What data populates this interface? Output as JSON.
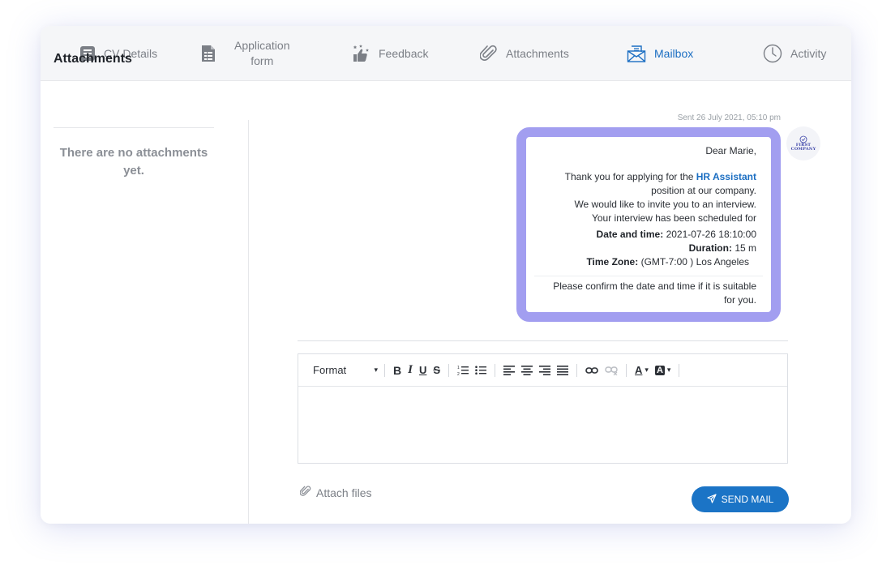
{
  "tabs": [
    {
      "label": "CV Details",
      "icon": "cv-icon"
    },
    {
      "label": "Application form",
      "line1": "Application",
      "line2": "form",
      "icon": "form-icon"
    },
    {
      "label": "Feedback",
      "icon": "thumbs-up-stars-icon"
    },
    {
      "label": "Attachments",
      "icon": "paperclip-icon"
    },
    {
      "label": "Mailbox",
      "icon": "mail-icon",
      "active": true
    },
    {
      "label": "Activity",
      "icon": "clock-icon"
    }
  ],
  "sidebar": {
    "title": "Attachments",
    "empty_line1": "There are no attachments",
    "empty_line2": "yet."
  },
  "message": {
    "sent": "Sent 26 July 2021, 05:10 pm",
    "greeting": "Dear Marie,",
    "line1_prefix": "Thank you for applying for the ",
    "position": "HR Assistant",
    "line2": "position at our company.",
    "line3": "We would like to invite you to an interview.",
    "line4": "Your interview has been scheduled for",
    "date_label": "Date and time:",
    "date_value": "2021-07-26 18:10:00",
    "duration_label": "Duration:",
    "duration_value": "15 m",
    "tz_label": "Time Zone:",
    "tz_value": "(GMT-7:00 )",
    "tz_city": "Los Angeles",
    "confirm1": "Please confirm the date and time if it is suitable",
    "confirm2": "for you."
  },
  "avatar": {
    "line1": "FIRST",
    "line2": "COMPANY"
  },
  "editor": {
    "format_label": "Format"
  },
  "actions": {
    "attach_label": "Attach files",
    "send_label": "SEND MAIL"
  },
  "colors": {
    "accent": "#1b6ec2",
    "bubble_border": "#a29ef0",
    "send_button": "#1b74c6"
  }
}
